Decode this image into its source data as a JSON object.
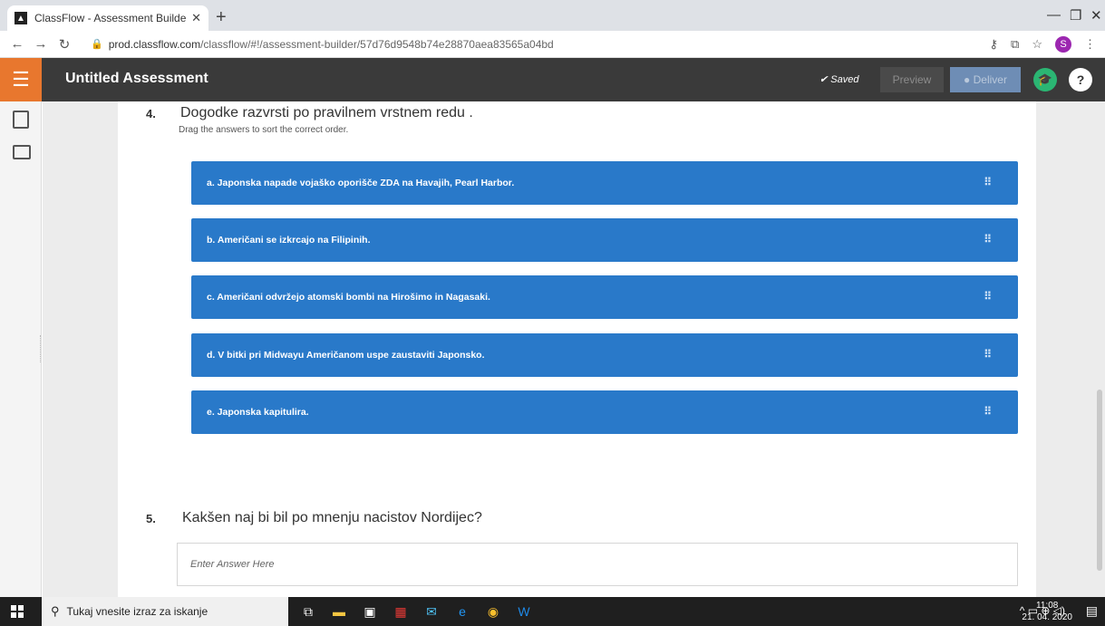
{
  "browser": {
    "tab_title": "ClassFlow - Assessment Builder",
    "url_host": "prod.classflow.com",
    "url_path": "/classflow/#!/assessment-builder/57d76d9548b74e28870aea83565a04bd",
    "profile_initial": "S"
  },
  "header": {
    "title": "Untitled Assessment",
    "saved_label": "Saved",
    "preview_label": "Preview",
    "deliver_label": "Deliver",
    "help_label": "?"
  },
  "question4": {
    "number": "4.",
    "text": "Dogodke razvrsti po pravilnem vrstnem redu .",
    "hint": "Drag the answers to sort the correct order.",
    "answers": [
      "a.  Japonska napade vojaško oporišče ZDA na Havajih, Pearl Harbor.",
      "b.  Američani se izkrcajo na Filipinih.",
      "c.  Američani odvržejo atomski bombi na Hirošimo in Nagasaki.",
      "d.  V bitki pri Midwayu Američanom uspe zaustaviti Japonsko.",
      "e.  Japonska kapitulira."
    ]
  },
  "question5": {
    "number": "5.",
    "text": "Kakšen naj bi bil po mnenju nacistov Nordijec?",
    "placeholder": "Enter Answer Here"
  },
  "taskbar": {
    "search_text": "Tukaj vnesite izraz za iskanje",
    "time": "11:08",
    "date": "21. 04. 2020"
  },
  "colors": {
    "accent_orange": "#e8772e",
    "answer_blue": "#2979c9",
    "header_dark": "#3a3a3a"
  }
}
